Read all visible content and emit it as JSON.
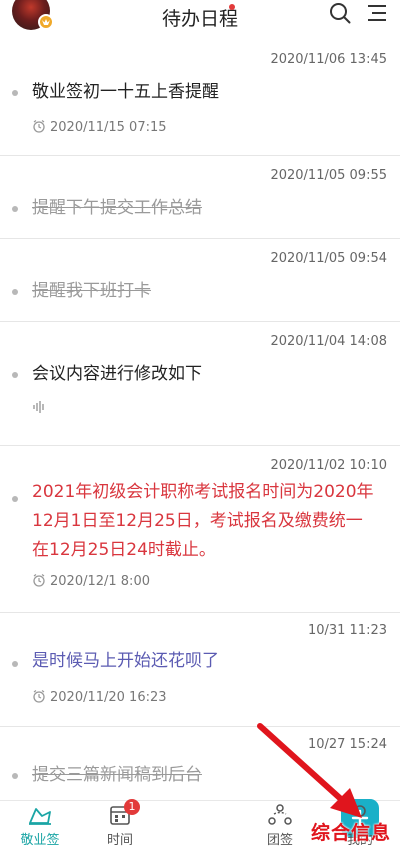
{
  "header": {
    "title": "待办日程",
    "notification_color": "#e23a3a"
  },
  "items": [
    {
      "timestamp": "2020/11/06 13:45",
      "text": "敬业签初一十五上香提醒",
      "style": "normal",
      "reminder": "2020/11/15 07:15"
    },
    {
      "timestamp": "2020/11/05 09:55",
      "text": "提醒下午提交工作总结",
      "style": "done"
    },
    {
      "timestamp": "2020/11/05 09:54",
      "text": "提醒我下班打卡",
      "style": "done"
    },
    {
      "timestamp": "2020/11/04 14:08",
      "text": "会议内容进行修改如下",
      "style": "normal",
      "has_voice": true
    },
    {
      "timestamp": "2020/11/02 10:10",
      "text_lines": [
        "2021年初级会计职称考试报名时间为2020年",
        "12月1日至12月25日，考试报名及缴费统一",
        "在12月25日24时截止。"
      ],
      "style": "red",
      "reminder": "2020/12/1 8:00"
    },
    {
      "timestamp": "10/31 11:23",
      "text": "是时候马上开始还花呗了",
      "style": "blue",
      "reminder": "2020/11/20 16:23"
    },
    {
      "timestamp": "10/27 15:24",
      "text": "提交三篇新闻稿到后台",
      "style": "done"
    }
  ],
  "tabbar": {
    "tabs": [
      {
        "label": "敬业签",
        "icon": "sign-icon",
        "active": true
      },
      {
        "label": "时间",
        "icon": "calendar-icon",
        "badge": "1"
      },
      {
        "label": "",
        "icon": "add-icon"
      },
      {
        "label": "团签",
        "icon": "team-icon"
      },
      {
        "label": "我的",
        "icon": "profile-icon"
      }
    ]
  },
  "overlay": {
    "watermark": "综合信息"
  },
  "colors": {
    "accent": "#1aa5a5",
    "red_text": "#d9363e",
    "blue_text": "#5b5bb2",
    "add_button": "#1ab0c8"
  }
}
